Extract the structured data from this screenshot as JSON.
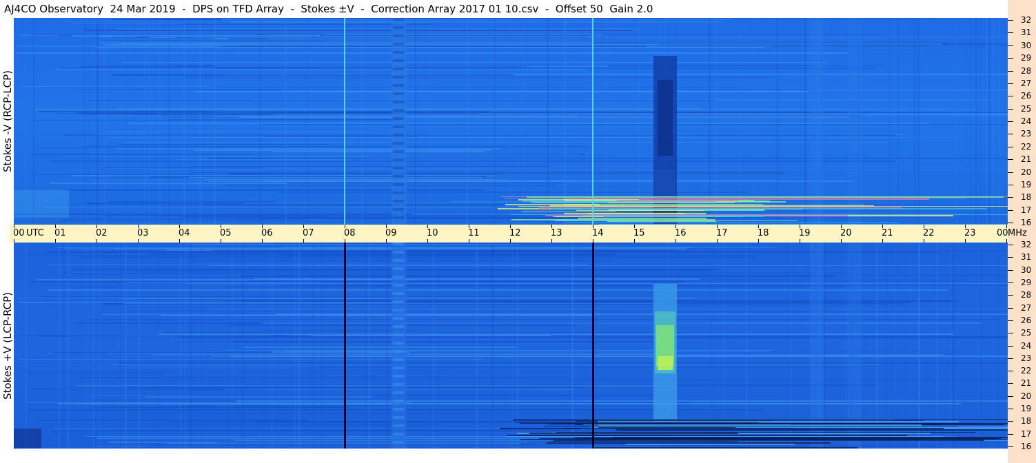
{
  "title": "AJ4CO Observatory  24 Mar 2019  -  DPS on TFD Array  -  Stokes ±V  -  Correction Array 2017 01 10.csv  -  Offset 50  Gain 2.0",
  "top_panel": {
    "ylabel": "Stokes -V (RCP-LCP)"
  },
  "bottom_panel": {
    "ylabel": "Stokes +V (LCP-RCP)"
  },
  "time_axis": {
    "labels": [
      "00",
      "01",
      "02",
      "03",
      "04",
      "05",
      "06",
      "07",
      "08",
      "09",
      "10",
      "11",
      "12",
      "13",
      "14",
      "15",
      "16",
      "17",
      "18",
      "19",
      "20",
      "21",
      "22",
      "23",
      "00"
    ],
    "unit_left": "UTC",
    "unit_right": "MHz"
  },
  "freq_axis": {
    "labels": [
      "32",
      "31",
      "30",
      "29",
      "28",
      "27",
      "26",
      "25",
      "24",
      "23",
      "22",
      "21",
      "20",
      "19",
      "18",
      "17",
      "16"
    ]
  },
  "colors": {
    "background_blue": "#1f6fe6",
    "axis_band": "#fff5c4",
    "right_strip": "#fde1c8"
  }
}
